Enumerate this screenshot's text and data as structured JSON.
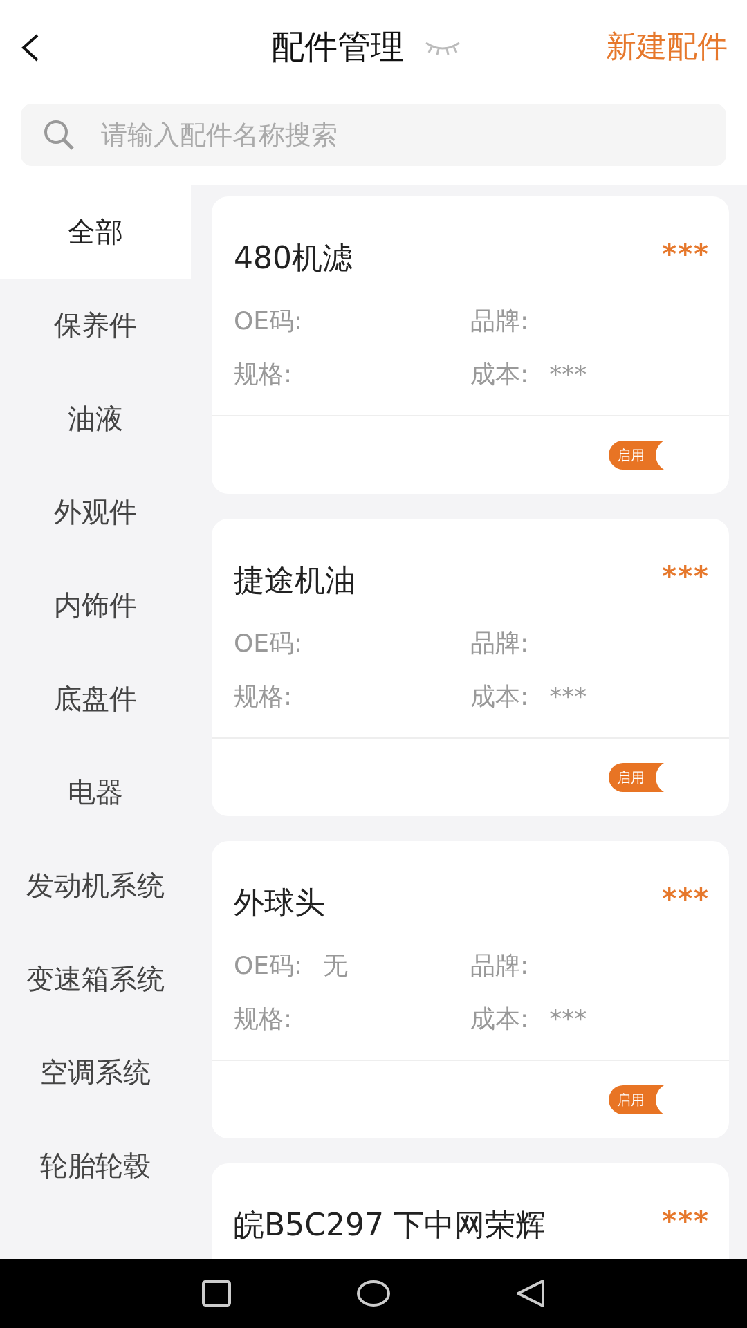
{
  "header": {
    "title": "配件管理",
    "action": "新建配件"
  },
  "search": {
    "placeholder": "请输入配件名称搜索"
  },
  "categories": [
    {
      "label": "全部",
      "selected": true
    },
    {
      "label": "保养件",
      "selected": false
    },
    {
      "label": "油液",
      "selected": false
    },
    {
      "label": "外观件",
      "selected": false
    },
    {
      "label": "内饰件",
      "selected": false
    },
    {
      "label": "底盘件",
      "selected": false
    },
    {
      "label": "电器",
      "selected": false
    },
    {
      "label": "发动机系统",
      "selected": false
    },
    {
      "label": "变速箱系统",
      "selected": false
    },
    {
      "label": "空调系统",
      "selected": false
    },
    {
      "label": "轮胎轮毂",
      "selected": false
    }
  ],
  "parts": [
    {
      "name": "480机滤",
      "price": "***",
      "fields": [
        {
          "label": "OE码:"
        },
        {
          "label": "品牌:"
        },
        {
          "label": "规格:"
        },
        {
          "label": "成本:",
          "value": "***"
        }
      ],
      "status": "启用"
    },
    {
      "name": "捷途机油",
      "price": "***",
      "fields": [
        {
          "label": "OE码:"
        },
        {
          "label": "品牌:"
        },
        {
          "label": "规格:"
        },
        {
          "label": "成本:",
          "value": "***"
        }
      ],
      "status": "启用"
    },
    {
      "name": "外球头",
      "price": "***",
      "fields": [
        {
          "label": "OE码:",
          "value": "无"
        },
        {
          "label": "品牌:"
        },
        {
          "label": "规格:"
        },
        {
          "label": "成本:",
          "value": "***"
        }
      ],
      "status": "启用"
    },
    {
      "name": "皖B5C297 下中网荣辉",
      "price": "***"
    }
  ]
}
